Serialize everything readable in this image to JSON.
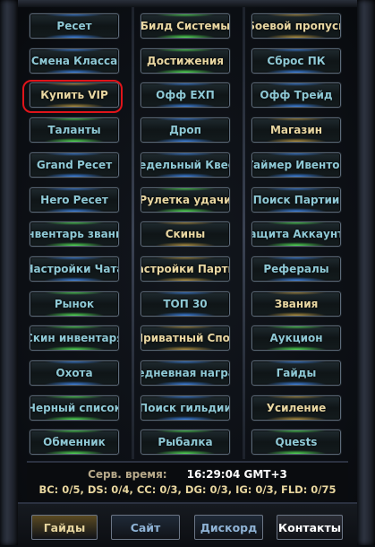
{
  "grid": [
    [
      {
        "label": "Ресет",
        "tone": "teal",
        "glow": "#3f8fff"
      },
      {
        "label": "Билд Системы",
        "tone": "gold",
        "glow": "#5aff5a"
      },
      {
        "label": "Боевой пропуск",
        "tone": "gold",
        "glow": "#c8a040"
      }
    ],
    [
      {
        "label": "Смена Класса",
        "tone": "teal",
        "glow": "#3f8fff"
      },
      {
        "label": "Достижения",
        "tone": "gold",
        "glow": "#5aff5a"
      },
      {
        "label": "Сброс ПК",
        "tone": "teal",
        "glow": "#3f8fff"
      }
    ],
    [
      {
        "label": "Купить VIP",
        "tone": "gold",
        "glow": "#c8a040"
      },
      {
        "label": "Офф ЕХП",
        "tone": "teal",
        "glow": "#3f8fff"
      },
      {
        "label": "Офф Трейд",
        "tone": "teal",
        "glow": "#3f8fff"
      }
    ],
    [
      {
        "label": "Таланты",
        "tone": "teal",
        "glow": "#5aff5a"
      },
      {
        "label": "Дроп",
        "tone": "teal",
        "glow": "#3f8fff"
      },
      {
        "label": "Магазин",
        "tone": "gold",
        "glow": "#c8a040"
      }
    ],
    [
      {
        "label": "Grand Ресет",
        "tone": "teal",
        "glow": "#3f8fff"
      },
      {
        "label": "Недельный Квест",
        "tone": "teal",
        "glow": "#3f8fff"
      },
      {
        "label": "Таймер Ивентов",
        "tone": "teal",
        "glow": "#3f8fff"
      }
    ],
    [
      {
        "label": "Hero Ресет",
        "tone": "teal",
        "glow": "#3f8fff"
      },
      {
        "label": "Рулетка удачи",
        "tone": "gold",
        "glow": "#5aff5a"
      },
      {
        "label": "Поиск Партии",
        "tone": "teal",
        "glow": "#3f8fff"
      }
    ],
    [
      {
        "label": "Инвентарь званий",
        "tone": "teal",
        "glow": "#5aff5a"
      },
      {
        "label": "Скины",
        "tone": "gold",
        "glow": "#c8a040"
      },
      {
        "label": "Защита Аккаунта",
        "tone": "teal",
        "glow": "#5aff5a"
      }
    ],
    [
      {
        "label": "Настройки Чата",
        "tone": "teal",
        "glow": "#3f8fff"
      },
      {
        "label": "Настройки Партии",
        "tone": "gold",
        "glow": "#c8a040"
      },
      {
        "label": "Рефералы",
        "tone": "teal",
        "glow": "#3f8fff"
      }
    ],
    [
      {
        "label": "Рынок",
        "tone": "teal",
        "glow": "#5aff5a"
      },
      {
        "label": "ТОП 30",
        "tone": "teal",
        "glow": "#3f8fff"
      },
      {
        "label": "Звания",
        "tone": "gold",
        "glow": "#c8a040"
      }
    ],
    [
      {
        "label": "Скин инвентаря",
        "tone": "teal",
        "glow": "#5aff5a"
      },
      {
        "label": "Приватный Спот",
        "tone": "gold",
        "glow": "#c8a040"
      },
      {
        "label": "Аукцион",
        "tone": "teal",
        "glow": "#5aff5a"
      }
    ],
    [
      {
        "label": "Охота",
        "tone": "teal",
        "glow": "#3f8fff"
      },
      {
        "label": "Ежедневная награда",
        "tone": "teal",
        "glow": "#3f8fff"
      },
      {
        "label": "Гайды",
        "tone": "teal",
        "glow": "#3f8fff"
      }
    ],
    [
      {
        "label": "Черный список",
        "tone": "teal",
        "glow": "#5aff5a"
      },
      {
        "label": "Поиск гильдии",
        "tone": "teal",
        "glow": "#3f8fff"
      },
      {
        "label": "Усиление",
        "tone": "gold",
        "glow": "#c8a040"
      }
    ],
    [
      {
        "label": "Обменник",
        "tone": "teal",
        "glow": "#5aff5a"
      },
      {
        "label": "Рыбалка",
        "tone": "teal",
        "glow": "#5aff5a"
      },
      {
        "label": "Quests",
        "tone": "teal",
        "glow": "#5aff5a"
      }
    ]
  ],
  "status": {
    "server_time_label": "Серв. время:",
    "server_time_value": "16:29:04 GMT+3",
    "counters": "BC: 0/5, DS: 0/4, CC: 0/3, DG: 0/3, IG: 0/3, FLD: 0/75"
  },
  "nav": [
    {
      "label": "Гайды",
      "color": "#e7d59e",
      "bg": "#5a4a22"
    },
    {
      "label": "Сайт",
      "color": "#8fb3d6",
      "bg": "#1f2a38"
    },
    {
      "label": "Дискорд",
      "color": "#8fb3d6",
      "bg": "#1f2a38"
    },
    {
      "label": "Контакты",
      "color": "#ffffff",
      "bg": "#2a2d35"
    }
  ],
  "colors": {
    "teal_text": "#8fb3d6",
    "gold_text": "#e9d7a2",
    "highlight_ring": "#e0141a"
  }
}
